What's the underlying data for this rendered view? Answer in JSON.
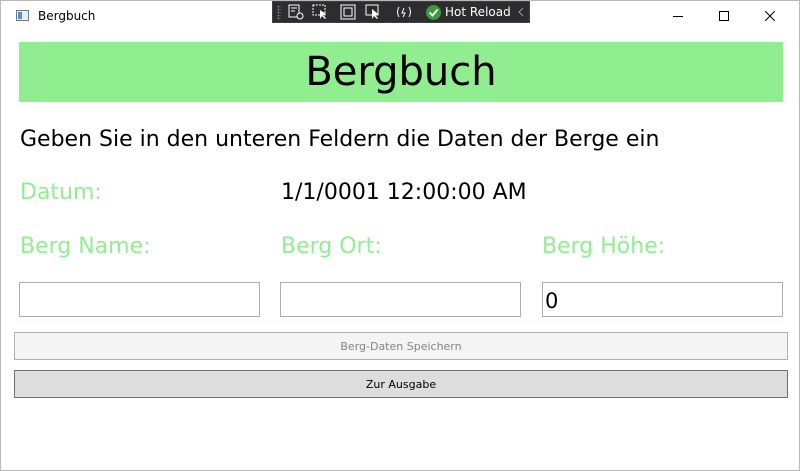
{
  "window": {
    "title": "Bergbuch"
  },
  "hot_reload": {
    "label": "Hot Reload",
    "icons": [
      "live-visual-tree-icon",
      "select-element-icon",
      "display-layout-adorners-icon",
      "track-focused-element-icon",
      "binding-failures-icon",
      "hot-reload-check-icon",
      "collapse-icon"
    ]
  },
  "header": {
    "title": "Bergbuch"
  },
  "instruction": "Geben Sie in den unteren Feldern die Daten der Berge ein",
  "datum": {
    "label": "Datum:",
    "value": "1/1/0001 12:00:00 AM"
  },
  "fields": {
    "name_label": "Berg Name:",
    "ort_label": "Berg Ort:",
    "hoehe_label": "Berg Höhe:",
    "name_value": "",
    "ort_value": "",
    "hoehe_value": "0"
  },
  "buttons": {
    "save_label": "Berg-Daten Speichern",
    "output_label": "Zur Ausgabe"
  },
  "colors": {
    "accent_green": "#90ee90",
    "toolbar_bg": "#2d2d30"
  }
}
